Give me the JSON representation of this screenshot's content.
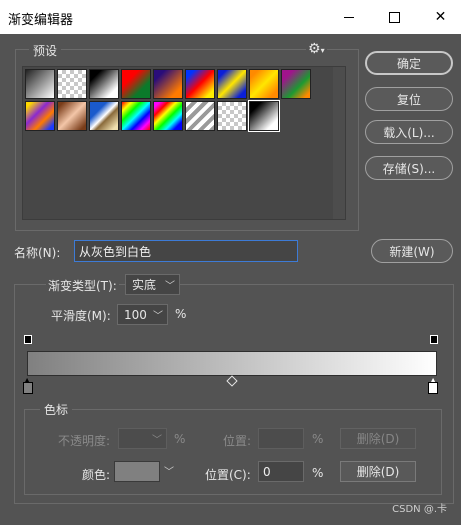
{
  "window": {
    "title": "渐变编辑器"
  },
  "presets": {
    "legend": "预设",
    "gear_icon": "gear-icon",
    "swatches": [
      {
        "name": "foreground-to-background",
        "bg": "linear-gradient(135deg,#222 0%,#fff 100%)"
      },
      {
        "name": "foreground-to-transparent",
        "bg": "checker"
      },
      {
        "name": "black-white",
        "bg": "linear-gradient(135deg,#000 20%,#fff 80%)"
      },
      {
        "name": "red-green",
        "bg": "linear-gradient(135deg,#ff0000 30%,#0b7a2a 70%)"
      },
      {
        "name": "violet-orange",
        "bg": "linear-gradient(135deg,#2a0d7a 20%,#ff7a00 80%)"
      },
      {
        "name": "blue-red-yellow",
        "bg": "linear-gradient(135deg,#0033ff 15%,#ff0000 50%,#ffee00 85%)"
      },
      {
        "name": "blue-yellow-blue",
        "bg": "linear-gradient(135deg,#0a1fd8 15%,#ffe600 50%,#0a1fd8 85%)"
      },
      {
        "name": "orange-yellow-orange",
        "bg": "linear-gradient(135deg,#ff8a00 15%,#ffe600 50%,#ff8a00 85%)"
      },
      {
        "name": "violet-green-orange",
        "bg": "linear-gradient(135deg,#a0148c 20%,#1c9a32 60%,#ff8a00 90%)"
      },
      {
        "name": "yellow-violet-orange-blue",
        "bg": "linear-gradient(135deg,#ffd800 10%,#8a2ad0 40%,#ff7a00 65%,#1a3aff 90%)"
      },
      {
        "name": "copper",
        "bg": "linear-gradient(135deg,#7a3d1a 10%,#f3c6a8 50%,#7a3d1a 90%)"
      },
      {
        "name": "chrome",
        "bg": "linear-gradient(135deg,#1a5acc 30%,#ffffff 50%,#8a6a3a 60%,#f0e0b0 90%)"
      },
      {
        "name": "spectrum",
        "bg": "linear-gradient(135deg,#ff0000,#ffff00,#00ff00,#00ffff,#0000ff,#ff00ff,#ff0000)"
      },
      {
        "name": "transparent-rainbow",
        "bg": "linear-gradient(135deg,#ff00ff 10%,#ff0000 25%,#ffff00 40%,#00ff00 55%,#00ffff 70%,#0000ff 85%)"
      },
      {
        "name": "transparent-stripes",
        "bg": "repeating-linear-gradient(135deg,#ffffff 0 4px,#9a9a9a 4px 8px)"
      },
      {
        "name": "checker-transparent",
        "bg": "checker"
      },
      {
        "name": "black-to-white-radial",
        "bg": "linear-gradient(135deg,#000 20%,#fff 80%)"
      }
    ]
  },
  "buttons": {
    "ok": "确定",
    "reset": "复位",
    "load": "载入(L)...",
    "save": "存储(S)...",
    "new": "新建(W)"
  },
  "name": {
    "label": "名称(N):",
    "value": "从灰色到白色"
  },
  "gradient": {
    "type_label": "渐变类型(T):",
    "type_value": "实底",
    "smoothness_label": "平滑度(M):",
    "smoothness_value": "100",
    "smoothness_unit": "%",
    "start_color": "#808080",
    "end_color": "#ffffff"
  },
  "stops": {
    "legend": "色标",
    "opacity_label": "不透明度:",
    "opacity_unit": "%",
    "opacity_location_label": "位置:",
    "opacity_location_unit": "%",
    "opacity_delete": "删除(D)",
    "color_label": "颜色:",
    "color_value": "#808080",
    "color_location_label": "位置(C):",
    "color_location_value": "0",
    "color_location_unit": "%",
    "color_delete": "删除(D)"
  },
  "watermark": "CSDN @.卡"
}
